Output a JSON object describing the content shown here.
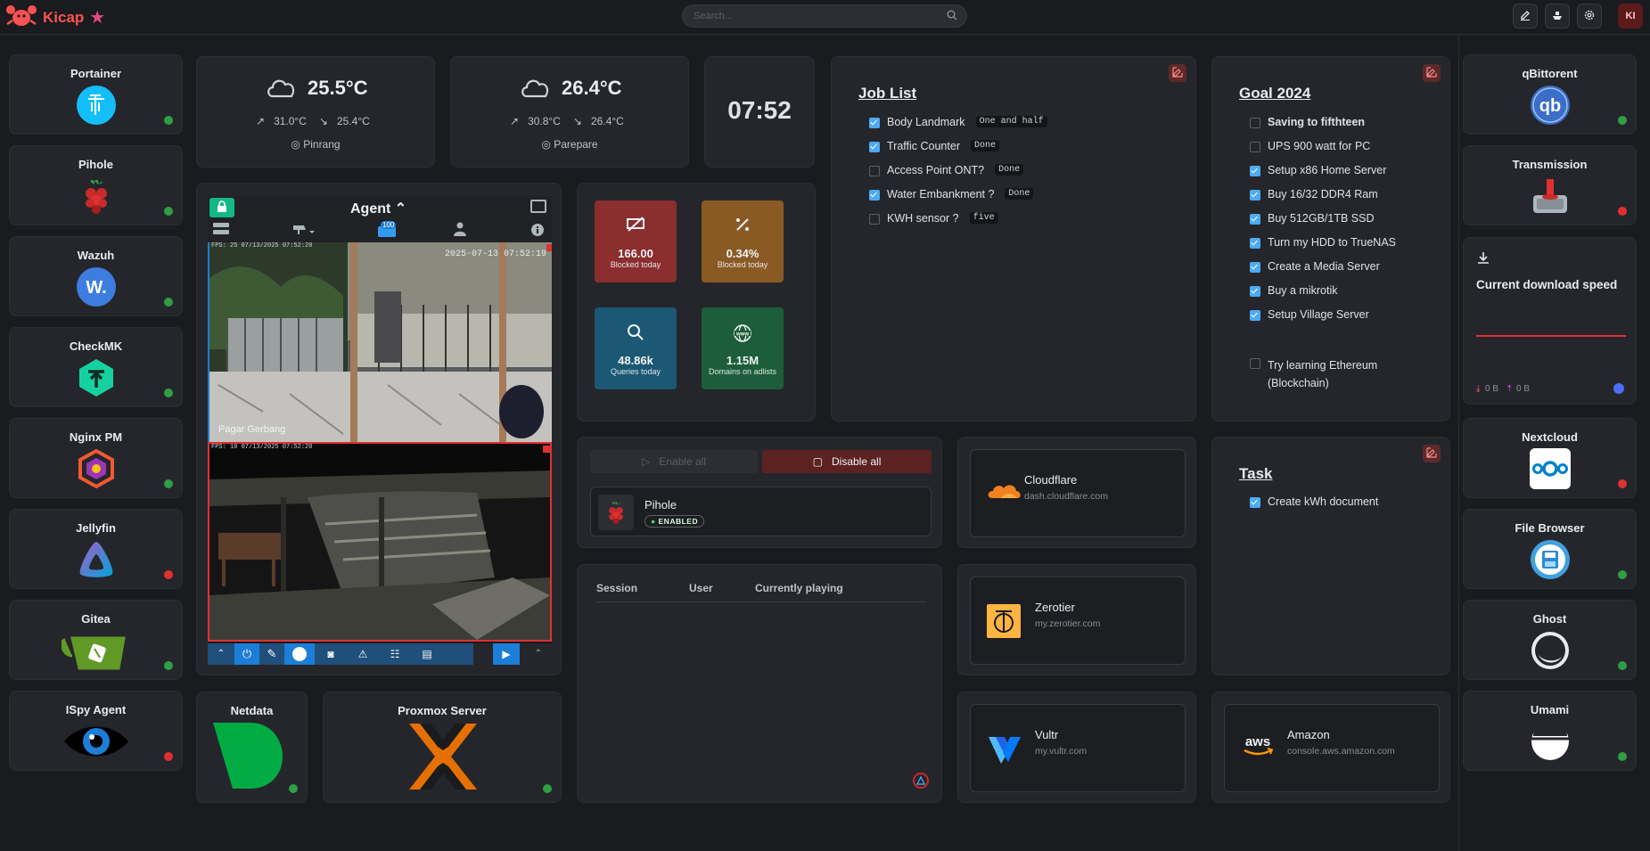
{
  "header": {
    "brand": "Kicap",
    "search_placeholder": "Search...",
    "avatar": "KI"
  },
  "left_apps": [
    {
      "name": "Portainer",
      "status": "ok"
    },
    {
      "name": "Pihole",
      "status": "ok"
    },
    {
      "name": "Wazuh",
      "status": "ok"
    },
    {
      "name": "CheckMK",
      "status": "ok"
    },
    {
      "name": "Nginx PM",
      "status": "ok"
    },
    {
      "name": "Jellyfin",
      "status": "bad"
    },
    {
      "name": "Gitea",
      "status": "ok"
    },
    {
      "name": "ISpy Agent",
      "status": "bad"
    }
  ],
  "right_apps": [
    {
      "name": "qBittorent",
      "status": "ok"
    },
    {
      "name": "Transmission",
      "status": "bad"
    },
    {
      "name": "Nextcloud",
      "status": "bad"
    },
    {
      "name": "File Browser",
      "status": "ok"
    },
    {
      "name": "Ghost",
      "status": "ok"
    },
    {
      "name": "Umami",
      "status": "ok"
    }
  ],
  "weather": [
    {
      "temp": "25.5°C",
      "high": "31.0°C",
      "low": "25.4°C",
      "city": "Pinrang"
    },
    {
      "temp": "26.4°C",
      "high": "30.8°C",
      "low": "26.4°C",
      "city": "Parepare"
    }
  ],
  "clock": "07:52",
  "agent": {
    "title": "Agent",
    "badge": "100",
    "cam1_label": "Pagar Gerbang",
    "cam1_fps": "FPS: 25 07/13/2025 07:52:20",
    "cam1_time": "2025-07-13 07:52:19",
    "cam2_fps": "FPS: 10 07/13/2025 07:52:20"
  },
  "pihole_stats": [
    {
      "value": "166.00",
      "label": "Blocked today",
      "color": "#8b2e2e"
    },
    {
      "value": "0.34%",
      "label": "Blocked today",
      "color": "#8a5a25"
    },
    {
      "value": "48.86k",
      "label": "Queries today",
      "color": "#1b5873"
    },
    {
      "value": "1.15M",
      "label": "Domains on adlists",
      "color": "#1d5e3a"
    }
  ],
  "job_list": {
    "title": "Job List",
    "items": [
      {
        "text": "Body Landmark",
        "tag": "One and half",
        "checked": true
      },
      {
        "text": "Traffic Counter",
        "tag": "Done",
        "checked": true
      },
      {
        "text": "Access Point ONT?",
        "tag": "Done",
        "checked": false
      },
      {
        "text": "Water Embankment ?",
        "tag": "Done",
        "checked": true
      },
      {
        "text": "KWH sensor ?",
        "tag": "five",
        "checked": false
      }
    ]
  },
  "goal": {
    "title": "Goal 2024",
    "items": [
      {
        "text": "Saving to fifthteen",
        "checked": false,
        "bold": true
      },
      {
        "text": "UPS 900 watt for PC",
        "checked": false
      },
      {
        "text": "Setup x86 Home Server",
        "checked": true
      },
      {
        "text": "Buy 16/32 DDR4 Ram",
        "checked": true
      },
      {
        "text": "Buy 512GB/1TB SSD",
        "checked": true
      },
      {
        "text": "Turn my HDD to TrueNAS",
        "checked": true
      },
      {
        "text": "Create a Media Server",
        "checked": true
      },
      {
        "text": "Buy a mikrotik",
        "checked": true
      },
      {
        "text": "Setup Village Server",
        "checked": true
      }
    ],
    "extra_line1": "Try learning Ethereum",
    "extra_line2": "(Blockchain)"
  },
  "task": {
    "title": "Task",
    "item": "Create kWh document"
  },
  "download": {
    "title": "Current download speed",
    "down": "0 B",
    "up": "0 B"
  },
  "dns_control": {
    "enable_all": "Enable all",
    "disable_all": "Disable all",
    "name": "Pihole",
    "status": "ENABLED"
  },
  "media": {
    "col_session": "Session",
    "col_user": "User",
    "col_playing": "Currently playing"
  },
  "links": [
    {
      "name": "Cloudflare",
      "url": "dash.cloudflare.com"
    },
    {
      "name": "Zerotier",
      "url": "my.zerotier.com"
    },
    {
      "name": "Vultr",
      "url": "my.vultr.com"
    },
    {
      "name": "Amazon",
      "url": "console.aws.amazon.com",
      "logo": "aws"
    }
  ],
  "bottom_apps": [
    {
      "name": "Netdata",
      "status": "ok"
    },
    {
      "name": "Proxmox Server",
      "status": "ok"
    }
  ]
}
